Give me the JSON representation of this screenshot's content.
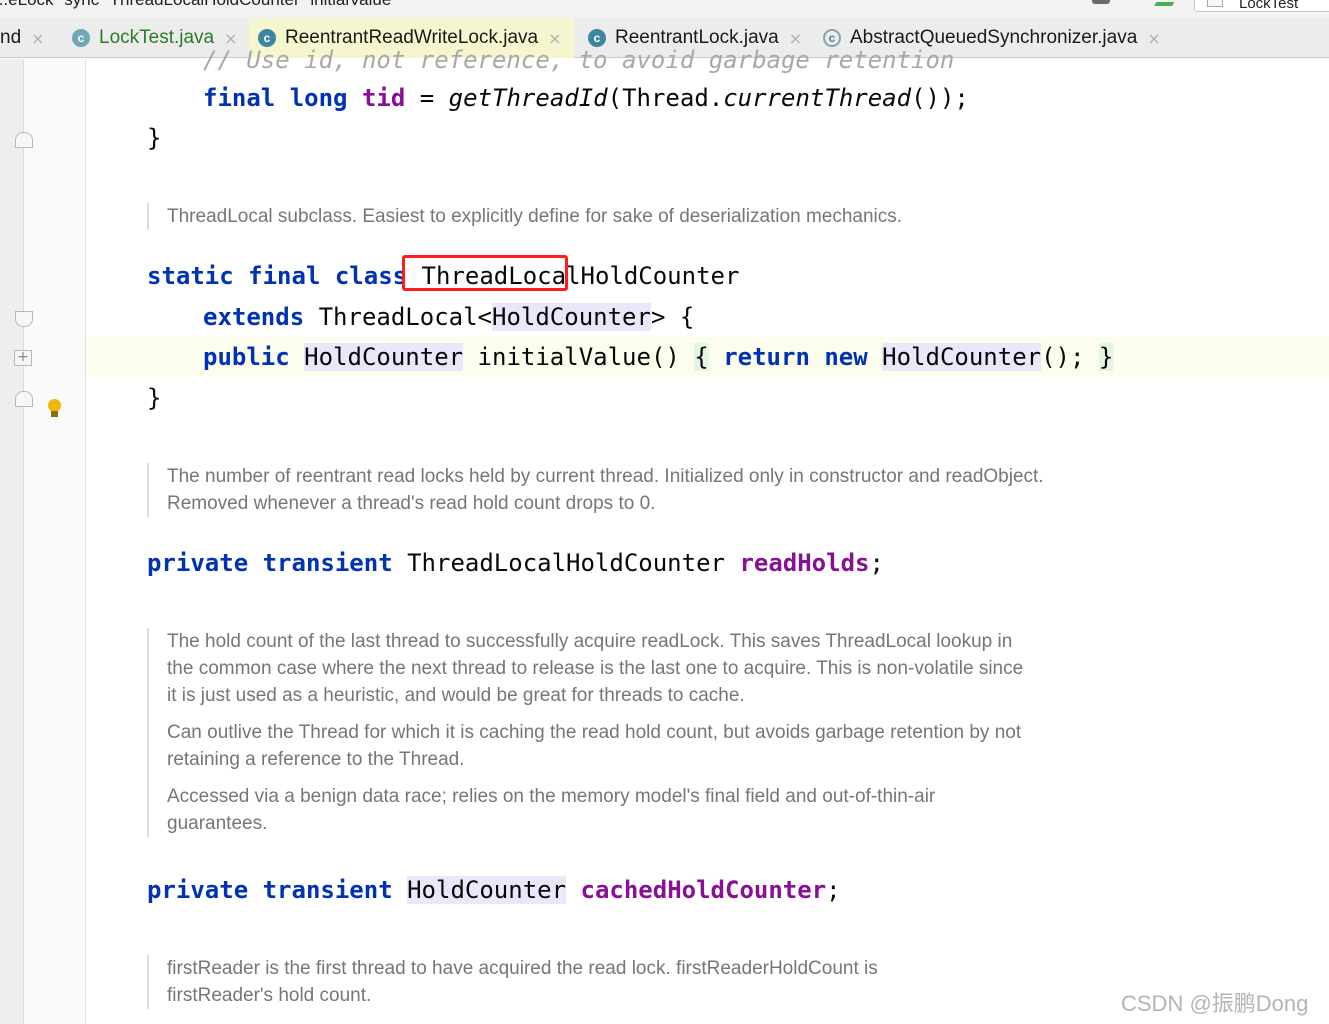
{
  "breadcrumb": {
    "items": [
      "...eLock",
      "sync",
      "ThreadLocalHoldCounter",
      "initialValue"
    ],
    "run_config": "LockTest"
  },
  "tabs": [
    {
      "label": "nd",
      "close": "×"
    },
    {
      "label": "LockTest.java",
      "close": "×"
    },
    {
      "label": "ReentrantReadWriteLock.java",
      "close": "×"
    },
    {
      "label": "ReentrantLock.java",
      "close": "×"
    },
    {
      "label": "AbstractQueuedSynchronizer.java",
      "close": "×"
    }
  ],
  "icons": {
    "class_letter": "c",
    "fold_plus": "+",
    "tab_icon": "class-icon",
    "bulb": "intention-bulb-icon"
  },
  "code": {
    "l0": "// Use id, not reference, to avoid garbage retention",
    "l1": {
      "kw": "final long",
      "fld": "tid",
      "eq": " = ",
      "call": "getThreadId",
      "open": "(Thread.",
      "call2": "currentThread",
      "close": "());"
    },
    "l2": "}",
    "doc1": "ThreadLocal subclass. Easiest to explicitly define for sake of deserialization mechanics.",
    "l3": {
      "kw": "static final class",
      "name": "ThreadLocalHoldCounter"
    },
    "l4": {
      "kw": "extends",
      "t1": "ThreadLocal<",
      "t2": "HoldCounter",
      "t3": "> {"
    },
    "l5": {
      "kw": "public",
      "t1": "HoldCounter",
      "t2": " initialValue() ",
      "b1": "{",
      "kw2": "return new",
      "t3": "HoldCounter",
      "t4": "(); ",
      "b2": "}"
    },
    "l6": "}",
    "doc2": "The number of reentrant read locks held by current thread. Initialized only in constructor and readObject. Removed whenever a thread's read hold count drops to 0.",
    "l7": {
      "kw": "private transient",
      "type": "ThreadLocalHoldCounter",
      "fld": "readHolds",
      "end": ";"
    },
    "doc3": [
      "The hold count of the last thread to successfully acquire readLock. This saves ThreadLocal lookup in the common case where the next thread to release is the last one to acquire. This is non-volatile since it is just used as a heuristic, and would be great for threads to cache.",
      "Can outlive the Thread for which it is caching the read hold count, but avoids garbage retention by not retaining a reference to the Thread.",
      "Accessed via a benign data race; relies on the memory model's final field and out-of-thin-air guarantees."
    ],
    "l8": {
      "kw": "private transient",
      "type": "HoldCounter",
      "fld": "cachedHoldCounter",
      "end": ";"
    },
    "doc4": "firstReader is the first thread to have acquired the read lock. firstReaderHoldCount is firstReader's hold count."
  },
  "watermark": "CSDN @振鹏Dong"
}
